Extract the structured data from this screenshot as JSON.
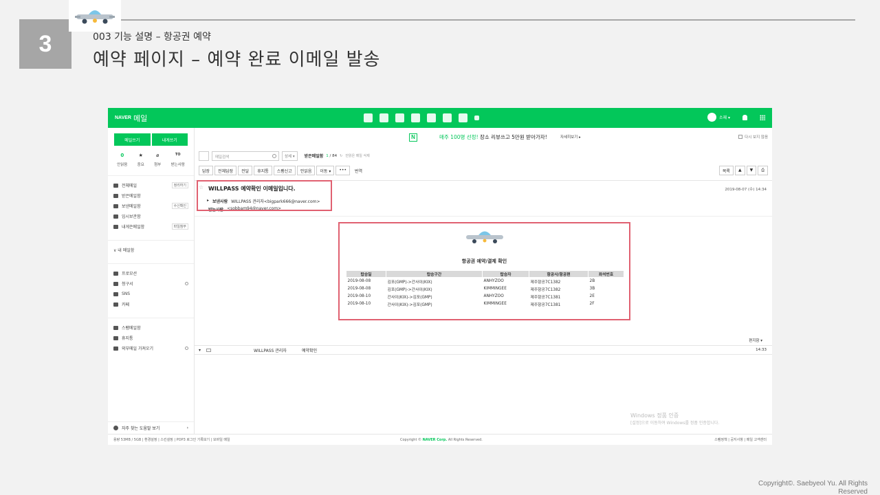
{
  "slide": {
    "number": "3",
    "subtitle": "003 기능 설명 – 항공권 예약",
    "title": "예약 페이지 – 예약 완료 이메일 발송",
    "copyright": "Copyright©. Saebyeol Yu. All Rights Reserved"
  },
  "gnb": {
    "logo": "NAVER",
    "app": "메일",
    "user": "소재 ▾"
  },
  "sidebar": {
    "compose": "메일쓰기",
    "to_me": "내게쓰기",
    "counts": [
      {
        "value": "0",
        "label": "안읽음"
      },
      {
        "value": "★",
        "label": "중요"
      },
      {
        "value": "⌀",
        "label": "첨부"
      },
      {
        "value": "TO",
        "label": "받는사람"
      }
    ],
    "folders": [
      {
        "label": "전체메일",
        "tag": "정리하기"
      },
      {
        "label": "받은메일함",
        "tag": ""
      },
      {
        "label": "보낸메일함",
        "tag": "수신확인"
      },
      {
        "label": "임시보관함",
        "tag": ""
      },
      {
        "label": "내게쓴메일함",
        "tag": "파일첨부"
      }
    ],
    "my_folder": "∨ 내 메일함",
    "apps": [
      "프로모션",
      "청구서",
      "SNS",
      "카페"
    ],
    "others": [
      "스팸메일함",
      "휴지통",
      "외부메일 가져오기"
    ],
    "help": "자주 찾는 도움말 보기"
  },
  "banner": {
    "text_highlight": "매주 100명 선정!",
    "text_rest": " 장소 리뷰쓰고 5만원 받아가자!",
    "detail": "자세히보기 ▸",
    "hide": "다시 보지 않음"
  },
  "toolbar": {
    "search_placeholder": "메일검색",
    "detail": "상세 ▾",
    "folder": "받은메일함",
    "counter_unread": "1",
    "counter_total": " / 84",
    "note": "안읽은 메일 삭제",
    "buttons": [
      "답장",
      "전체답장",
      "전달",
      "휴지통",
      "스팸신고",
      "안읽음",
      "이동 ▾",
      "•••"
    ],
    "translate": "번역",
    "list": "목록"
  },
  "mail": {
    "subject": "WILLPASS 예약확인 이메일입니다.",
    "date": "2019-08-07 (수) 14:34",
    "from_label": "보낸사람",
    "from": "WILLPASS 관리자<bigpark666@naver.com>",
    "to_label": "받는사람",
    "to": "<sobbam94@naver.com>"
  },
  "receipt": {
    "title": "항공권 예약/결제 확인",
    "headers": [
      "탑승일",
      "탑승구간",
      "탑승자",
      "항공사/항공편",
      "좌석번호"
    ],
    "rows": [
      [
        "2019-08-08",
        "김포(GMP)->간사이(KIX)",
        "ANHYZOO",
        "제주항공7C1382",
        "2B"
      ],
      [
        "2019-08-08",
        "김포(GMP)->간사이(KIX)",
        "KIMMINGEE",
        "제주항공7C1382",
        "3B"
      ],
      [
        "2019-08-10",
        "간사이(KIX)->김포(GMP)",
        "ANHYZOO",
        "제주항공7C1381",
        "2E"
      ],
      [
        "2019-08-10",
        "간사이(KIX)->김포(GMP)",
        "KIMMINGEE",
        "제주항공7C1381",
        "2F"
      ]
    ]
  },
  "print": "편지함 ▾",
  "list_row": {
    "sender": "WILLPASS 관리자",
    "subject": "예약확인",
    "time": "14:33"
  },
  "watermark": {
    "line1": "Windows 정품 인증",
    "line2": "[설정]으로 이동하여 Windows를 정품 인증합니다."
  },
  "footer": {
    "left": "용량 53MB / 5GB  |  환경설정  |  스킨설정  |  POP3 로그인 기록보기  |  모바일 메일",
    "center_prefix": "Copyright © ",
    "center_brand": "NAVER Corp.",
    "center_suffix": " All Rights Reserved.",
    "right": "스팸정책  |  공지사항  |  메일 고객센터"
  },
  "colors": {
    "naver_green": "#03c75a",
    "highlight_red": "#e06070",
    "slide_gray": "#a6a6a6"
  }
}
